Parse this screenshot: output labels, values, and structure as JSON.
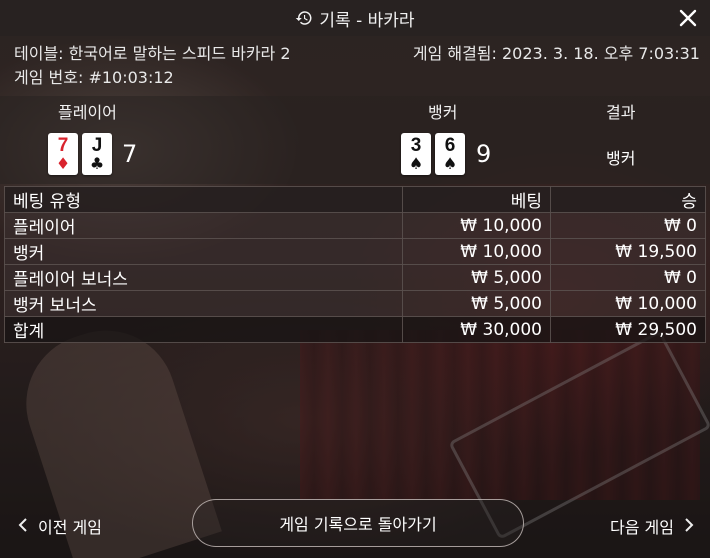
{
  "header": {
    "title": "기록 - 바카라",
    "history_icon": "history-icon",
    "close_icon": "close-icon"
  },
  "info": {
    "table_label": "테이블: 한국어로 말하는 스피드 바카라 2",
    "resolved_label": "게임 해결됨: 2023. 3. 18. 오후 7:03:31",
    "game_number_label": "게임 번호: #10:03:12"
  },
  "results": {
    "player_header": "플레이어",
    "banker_header": "뱅커",
    "result_header": "결과",
    "player_cards": [
      {
        "rank": "7",
        "suit": "♦",
        "color": "#d9232d"
      },
      {
        "rank": "J",
        "suit": "♣",
        "color": "#111111"
      }
    ],
    "player_score": "7",
    "banker_cards": [
      {
        "rank": "3",
        "suit": "♠",
        "color": "#111111"
      },
      {
        "rank": "6",
        "suit": "♠",
        "color": "#111111"
      }
    ],
    "banker_score": "9",
    "result_value": "뱅커"
  },
  "bets": {
    "columns": [
      "베팅 유형",
      "베팅",
      "승"
    ],
    "rows": [
      {
        "type": "플레이어",
        "bet": "₩ 10,000",
        "win": "₩ 0"
      },
      {
        "type": "뱅커",
        "bet": "₩ 10,000",
        "win": "₩ 19,500"
      },
      {
        "type": "플레이어 보너스",
        "bet": "₩ 5,000",
        "win": "₩ 0"
      },
      {
        "type": "뱅커 보너스",
        "bet": "₩ 5,000",
        "win": "₩ 10,000"
      }
    ],
    "total": {
      "type": "합계",
      "bet": "₩ 30,000",
      "win": "₩ 29,500"
    }
  },
  "footer": {
    "prev_label": "이전 게임",
    "back_label": "게임 기록으로 돌아가기",
    "next_label": "다음 게임"
  }
}
